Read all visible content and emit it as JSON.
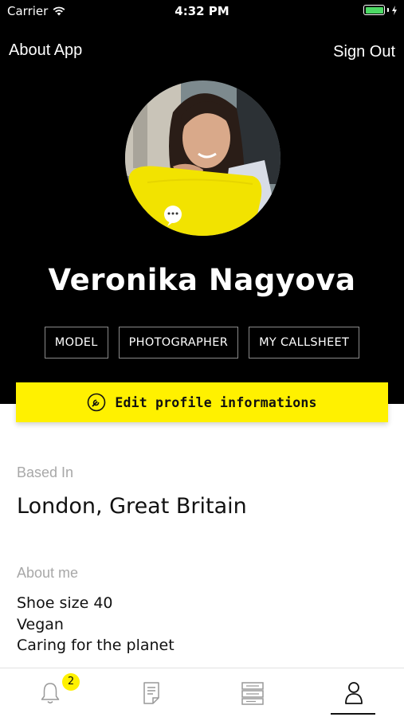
{
  "status_bar": {
    "carrier": "Carrier",
    "time": "4:32 PM"
  },
  "nav": {
    "about_label": "About App",
    "signout_label": "Sign Out"
  },
  "profile": {
    "name": "Veronika Nagyova",
    "roles": [
      "MODEL",
      "PHOTOGRAPHER",
      "MY CALLSHEET"
    ]
  },
  "edit_button": {
    "label": "Edit profile informations",
    "icon": "wrench-icon"
  },
  "based_in": {
    "label": "Based In",
    "value": "London, Great Britain"
  },
  "about_me": {
    "label": "About me",
    "lines": [
      "Shoe size 40",
      "Vegan",
      "Caring for the planet"
    ]
  },
  "tab_bar": {
    "notifications_badge": "2",
    "tabs": [
      {
        "icon": "bell-icon"
      },
      {
        "icon": "document-icon"
      },
      {
        "icon": "callsheet-icon"
      },
      {
        "icon": "profile-icon",
        "active": true
      }
    ]
  },
  "colors": {
    "accent": "#fff100",
    "header_bg": "#000000",
    "battery": "#4cd964",
    "label_gray": "#a8a8a8"
  }
}
